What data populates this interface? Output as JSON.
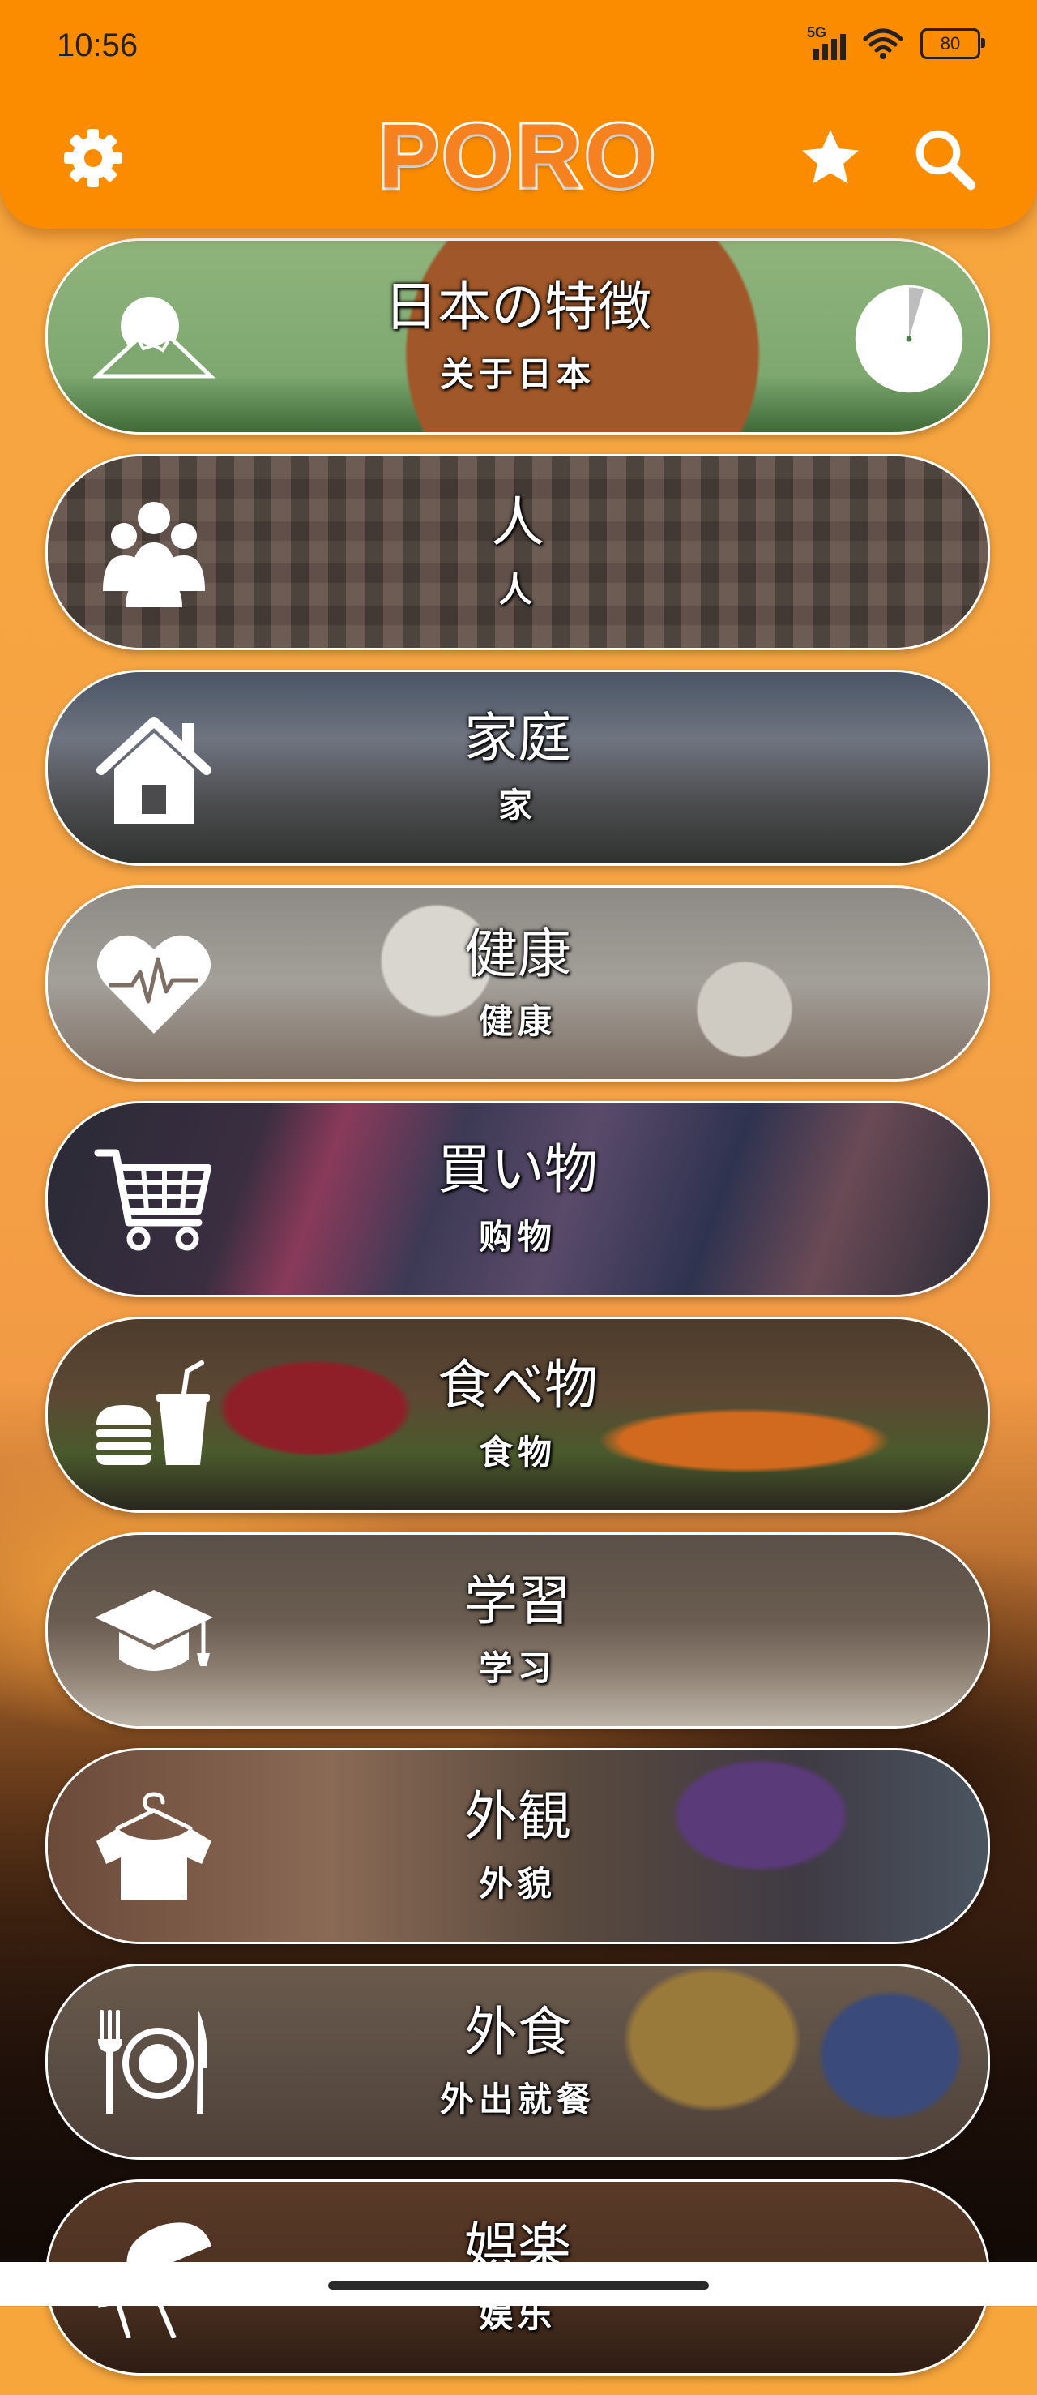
{
  "status_bar": {
    "time": "10:56",
    "network": "5G",
    "battery": "80"
  },
  "header": {
    "logo": "PORO",
    "settings_icon": "gear-icon",
    "favorites_icon": "star-icon",
    "search_icon": "search-icon"
  },
  "colors": {
    "header_bg": "#fb8c00",
    "logo_orange": "#f5821f",
    "card_border": "#ffffff",
    "text": "#ffffff"
  },
  "categories": [
    {
      "jp": "日本の特徴",
      "cn": "关于日本",
      "icon": "mount-fuji-icon",
      "progress": 0.05
    },
    {
      "jp": "人",
      "cn": "人",
      "icon": "people-group-icon"
    },
    {
      "jp": "家庭",
      "cn": "家",
      "icon": "house-icon"
    },
    {
      "jp": "健康",
      "cn": "健康",
      "icon": "heart-pulse-icon"
    },
    {
      "jp": "買い物",
      "cn": "购物",
      "icon": "shopping-cart-icon"
    },
    {
      "jp": "食べ物",
      "cn": "食物",
      "icon": "burger-drink-icon"
    },
    {
      "jp": "学習",
      "cn": "学习",
      "icon": "graduation-cap-icon"
    },
    {
      "jp": "外観",
      "cn": "外貌",
      "icon": "clothes-hanger-icon"
    },
    {
      "jp": "外食",
      "cn": "外出就餐",
      "icon": "fork-plate-knife-icon"
    },
    {
      "jp": "娯楽",
      "cn": "娱乐",
      "icon": "beach-umbrella-icon"
    }
  ]
}
